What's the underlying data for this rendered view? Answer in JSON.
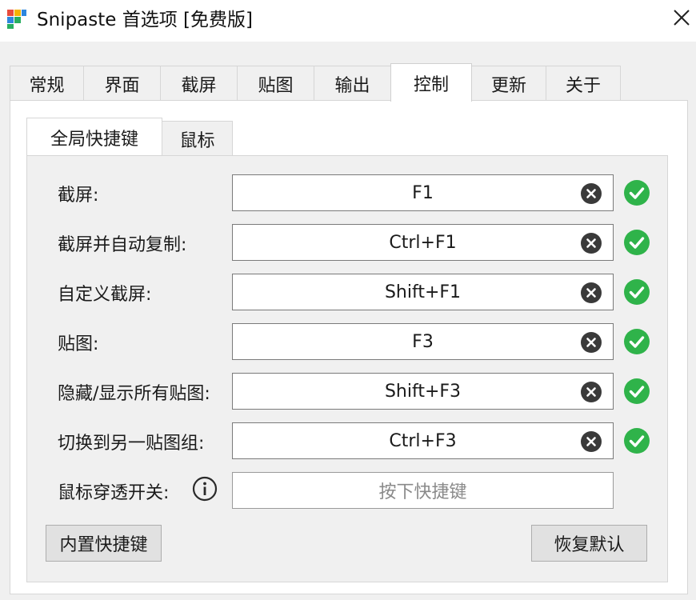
{
  "window": {
    "title": "Snipaste 首选项 [免费版]"
  },
  "tabs": [
    {
      "label": "常规"
    },
    {
      "label": "界面"
    },
    {
      "label": "截屏"
    },
    {
      "label": "贴图"
    },
    {
      "label": "输出"
    },
    {
      "label": "控制"
    },
    {
      "label": "更新"
    },
    {
      "label": "关于"
    }
  ],
  "subtabs": [
    {
      "label": "全局快捷键"
    },
    {
      "label": "鼠标"
    }
  ],
  "hotkeys": [
    {
      "label": "截屏:",
      "value": "F1"
    },
    {
      "label": "截屏并自动复制:",
      "value": "Ctrl+F1"
    },
    {
      "label": "自定义截屏:",
      "value": "Shift+F1"
    },
    {
      "label": "贴图:",
      "value": "F3"
    },
    {
      "label": "隐藏/显示所有贴图:",
      "value": "Shift+F3"
    },
    {
      "label": "切换到另一贴图组:",
      "value": "Ctrl+F3"
    }
  ],
  "mouse_passthrough": {
    "label": "鼠标穿透开关:",
    "value": "",
    "placeholder": "按下快捷键"
  },
  "buttons": {
    "builtin": "内置快捷键",
    "restore": "恢复默认"
  },
  "colors": {
    "ok_green": "#2fb34a",
    "clear_dark": "#3a3a3a"
  },
  "icons": {
    "logo": "snipaste-logo-icon",
    "close": "close-icon",
    "clear": "clear-icon",
    "ok": "check-circle-icon",
    "info": "info-icon"
  }
}
